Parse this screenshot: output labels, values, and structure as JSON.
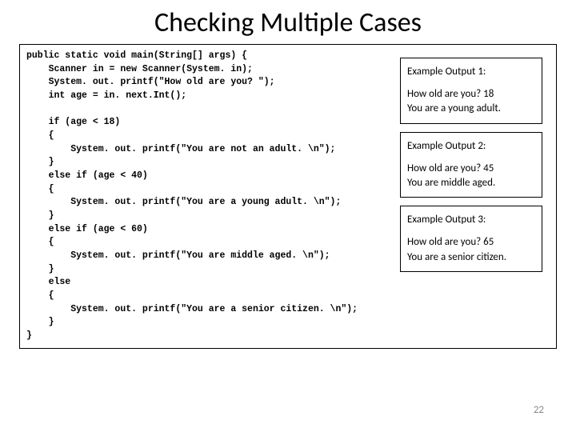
{
  "title": "Checking Multiple Cases",
  "code": "public static void main(String[] args) {\n    Scanner in = new Scanner(System. in);\n    System. out. printf(\"How old are you? \");\n    int age = in. next.Int();\n\n    if (age < 18)\n    {\n        System. out. printf(\"You are not an adult. \\n\");\n    }\n    else if (age < 40)\n    {\n        System. out. printf(\"You are a young adult. \\n\");\n    }\n    else if (age < 60)\n    {\n        System. out. printf(\"You are middle aged. \\n\");\n    }\n    else\n    {\n        System. out. printf(\"You are a senior citizen. \\n\");\n    }\n}",
  "examples": [
    {
      "label": "Example Output 1:",
      "prompt": "How old are you? 18",
      "response": "You are a young adult."
    },
    {
      "label": "Example Output 2:",
      "prompt": "How old are you? 45",
      "response": "You are middle aged."
    },
    {
      "label": "Example Output 3:",
      "prompt": "How old are you? 65",
      "response": "You are a senior citizen."
    }
  ],
  "page_number": "22"
}
